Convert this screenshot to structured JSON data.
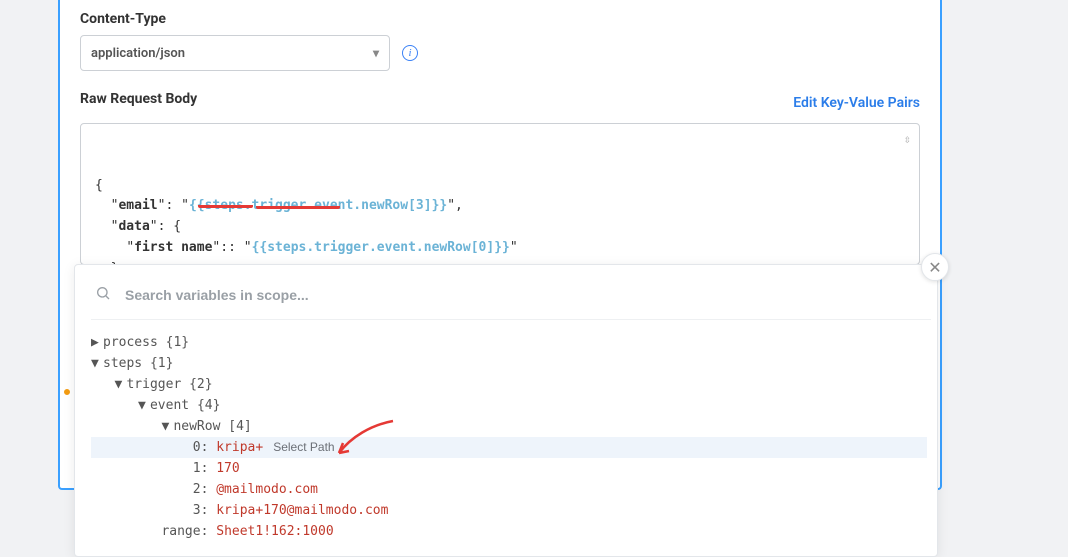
{
  "contentType": {
    "label": "Content-Type",
    "value": "application/json"
  },
  "rawBody": {
    "label": "Raw Request Body",
    "editLink": "Edit Key-Value Pairs",
    "json": {
      "emailKey": "email",
      "emailVal": "{{steps.trigger.event.newRow[3]}}",
      "dataKey": "data",
      "firstNameKey": "first name",
      "firstNameVal": "{{steps.trigger.event.newRow[0]}}"
    }
  },
  "popup": {
    "searchPlaceholder": "Search variables in scope...",
    "selectPathLabel": "Select Path",
    "tree": {
      "process": {
        "label": "process",
        "count": "{1}"
      },
      "steps": {
        "label": "steps",
        "count": "{1}"
      },
      "trigger": {
        "label": "trigger",
        "count": "{2}"
      },
      "event": {
        "label": "event",
        "count": "{4}"
      },
      "newRow": {
        "label": "newRow",
        "count": "[4]"
      },
      "rows": [
        {
          "idx": "0:",
          "val": "kripa+"
        },
        {
          "idx": "1:",
          "val": "170"
        },
        {
          "idx": "2:",
          "val": "@mailmodo.com"
        },
        {
          "idx": "3:",
          "val": "kripa+170@mailmodo.com"
        }
      ],
      "range": {
        "label": "range:",
        "val": "Sheet1!162:1000"
      }
    }
  }
}
